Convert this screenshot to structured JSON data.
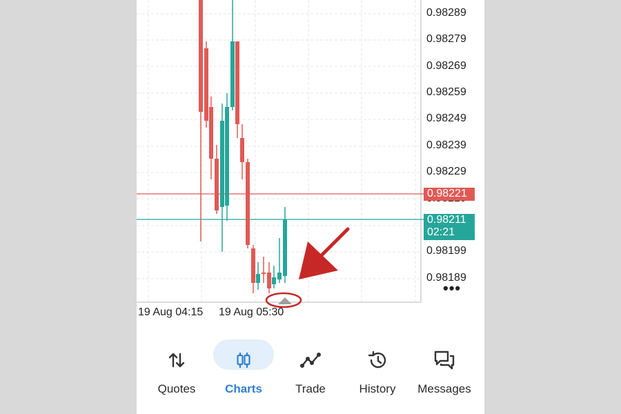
{
  "chart": {
    "price_levels": [
      "0.98289",
      "0.98279",
      "0.98269",
      "0.98259",
      "0.98249",
      "0.98239",
      "0.98229",
      "0.98219",
      "0.98199",
      "0.98189"
    ],
    "ask_price": "0.98221",
    "bid_price": "0.98211",
    "countdown": "02:21",
    "time_labels": [
      "19 Aug 04:15",
      "19 Aug 05:30"
    ],
    "more_label": "•••",
    "colors": {
      "bull": "#26a69a",
      "bear": "#e05a55",
      "grid": "#e6e6e6",
      "annotation": "#c62828"
    }
  },
  "nav": {
    "items": [
      {
        "label": "Quotes",
        "icon": "quotes-arrows-icon",
        "active": false
      },
      {
        "label": "Charts",
        "icon": "candlestick-icon",
        "active": true
      },
      {
        "label": "Trade",
        "icon": "trend-line-icon",
        "active": false
      },
      {
        "label": "History",
        "icon": "history-clock-icon",
        "active": false
      },
      {
        "label": "Messages",
        "icon": "messages-icon",
        "active": false
      }
    ]
  }
}
